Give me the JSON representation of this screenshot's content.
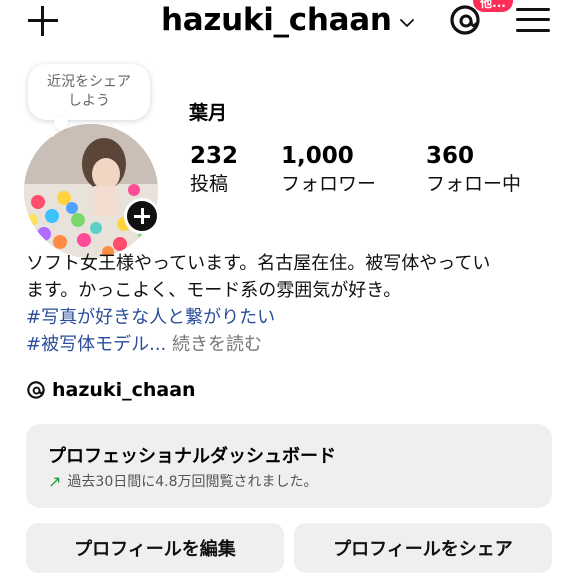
{
  "header": {
    "username": "hazuki_chaan",
    "threads_badge": "他..."
  },
  "profile": {
    "note_bubble": "近況をシェア しよう",
    "display_name": "葉月",
    "stats": [
      {
        "value": "232",
        "label": "投稿"
      },
      {
        "value": "1,000",
        "label": "フォロワー"
      },
      {
        "value": "360",
        "label": "フォロー中"
      }
    ]
  },
  "bio": {
    "line1": "ソフト女王様やっています。名古屋在住。被写体やってい",
    "line2": "ます。かっこよく、モード系の雰囲気が好き。",
    "hashtag1": "#写真が好きな人と繋がりたい",
    "hashtag2": "#被写体モデル",
    "ellipsis": "...",
    "more": " 続きを読む"
  },
  "threads_link": {
    "handle": "hazuki_chaan"
  },
  "dashboard": {
    "title": "プロフェッショナルダッシュボード",
    "subtitle": "過去30日間に4.8万回閲覧されました。"
  },
  "buttons": {
    "edit_profile": "プロフィールを編集",
    "share_profile": "プロフィールをシェア"
  },
  "colors": {
    "hashtag": "#2b4e9b",
    "badge": "#ff2d55",
    "trend_arrow": "#1a9c3d",
    "button_bg": "#efefef"
  }
}
